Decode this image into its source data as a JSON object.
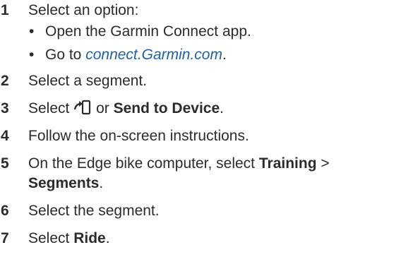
{
  "steps": [
    {
      "num": "1",
      "text": "Select an option:"
    },
    {
      "num": "2",
      "text": "Select a segment."
    },
    {
      "num": "3",
      "pre": "Select",
      "mid": "or",
      "bold": "Send to Device",
      "post": "."
    },
    {
      "num": "4",
      "text": "Follow the on-screen instructions."
    },
    {
      "num": "5",
      "pre": "On the Edge bike computer, select",
      "bold1": "Training",
      "sep": ">",
      "bold2": "Segments",
      "post": "."
    },
    {
      "num": "6",
      "text": "Select the segment."
    },
    {
      "num": "7",
      "pre": "Select",
      "bold": "Ride",
      "post": "."
    }
  ],
  "substeps": [
    {
      "bullet": "•",
      "text": "Open the Garmin Connect app."
    },
    {
      "bullet": "•",
      "pre": "Go to",
      "link": "connect.Garmin.com",
      "post": "."
    }
  ],
  "icons": {
    "send_icon": "phone-send-icon"
  }
}
